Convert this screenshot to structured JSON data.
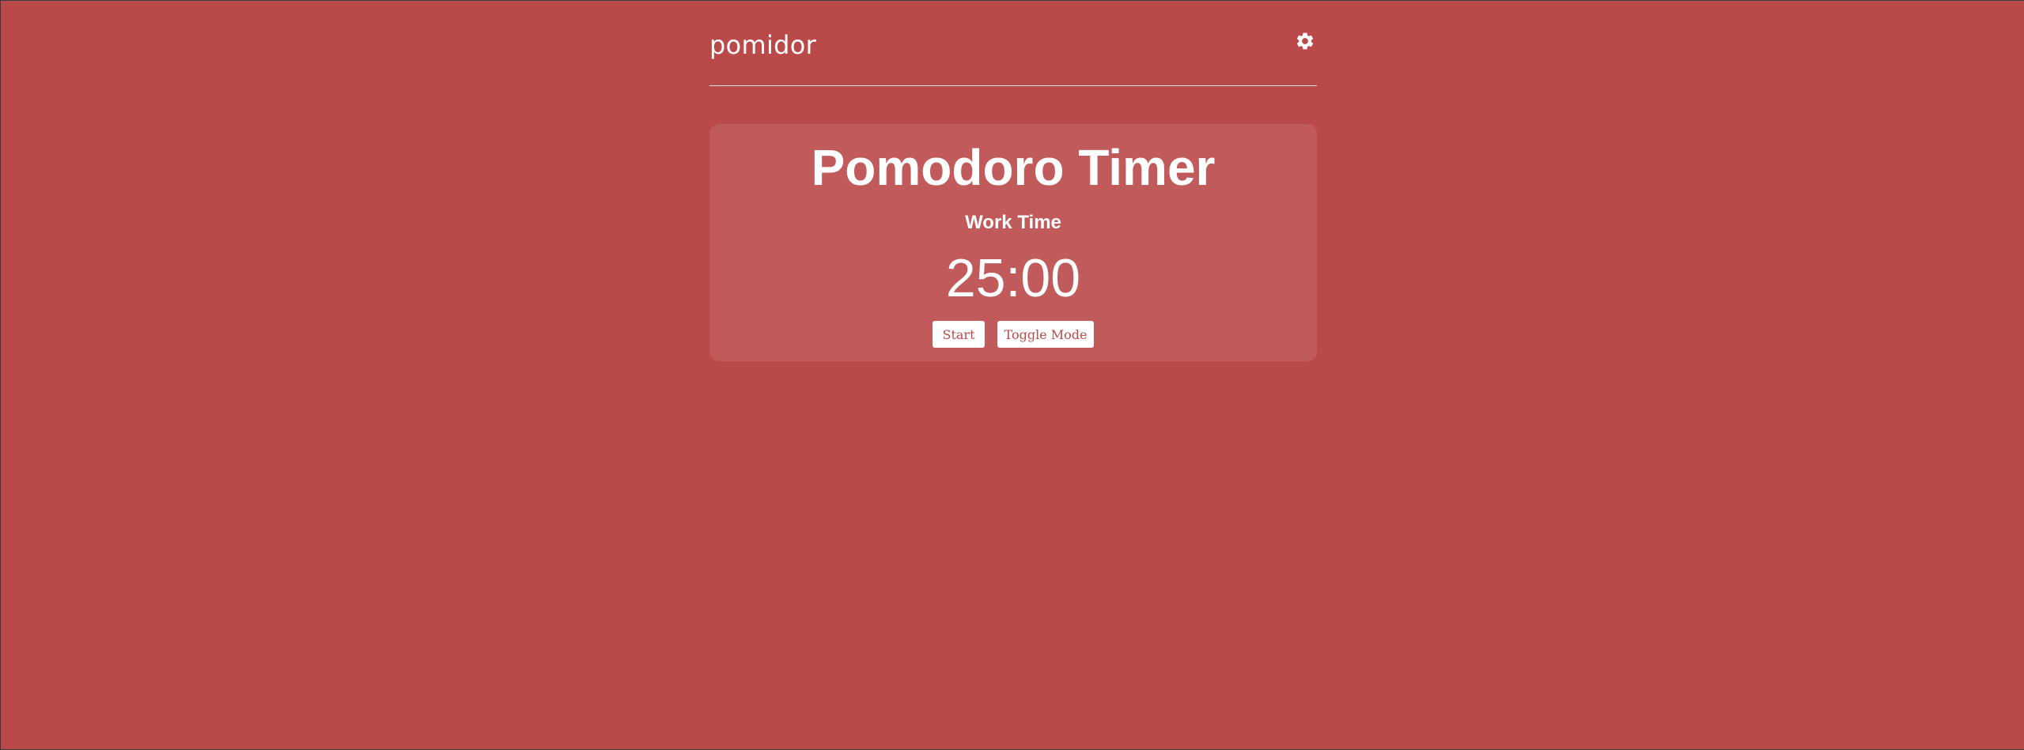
{
  "header": {
    "logo": "pomidor",
    "settings_icon": "gear-icon"
  },
  "timer": {
    "title": "Pomodoro Timer",
    "mode": "Work Time",
    "time": "25:00",
    "start_label": "Start",
    "toggle_label": "Toggle Mode"
  },
  "colors": {
    "background": "#ba4949",
    "card": "rgba(255,255,255,0.1)",
    "text": "#ffffff",
    "button_text": "#ba4949"
  }
}
